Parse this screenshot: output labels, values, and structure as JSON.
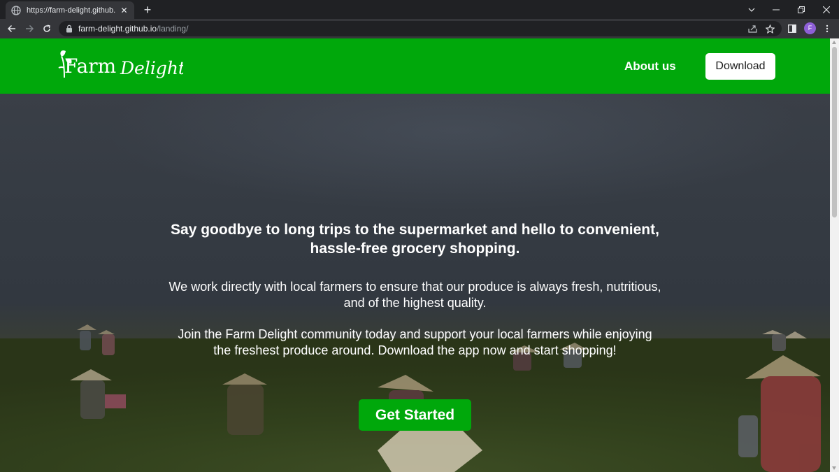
{
  "browser": {
    "tab_title": "https://farm-delight.github.io/lan",
    "url_host": "farm-delight.github.io",
    "url_path": "/landing/",
    "profile_initial": "F"
  },
  "site": {
    "logo_text_1": "Farm",
    "logo_text_2": "Delight",
    "nav_about": "About us",
    "download_label": "Download"
  },
  "hero": {
    "title": "Say goodbye to long trips to the supermarket and hello to convenient, hassle-free grocery shopping.",
    "paragraph_1": "We work directly with local farmers to ensure that our produce is always fresh, nutritious, and of the highest quality.",
    "paragraph_2": "Join the Farm Delight community today and support your local farmers while enjoying the freshest produce around. Download the app now and start shopping!",
    "cta_label": "Get Started"
  },
  "colors": {
    "brand_green": "#00a80b",
    "chrome_dark": "#202124",
    "chrome_toolbar": "#35363a"
  }
}
